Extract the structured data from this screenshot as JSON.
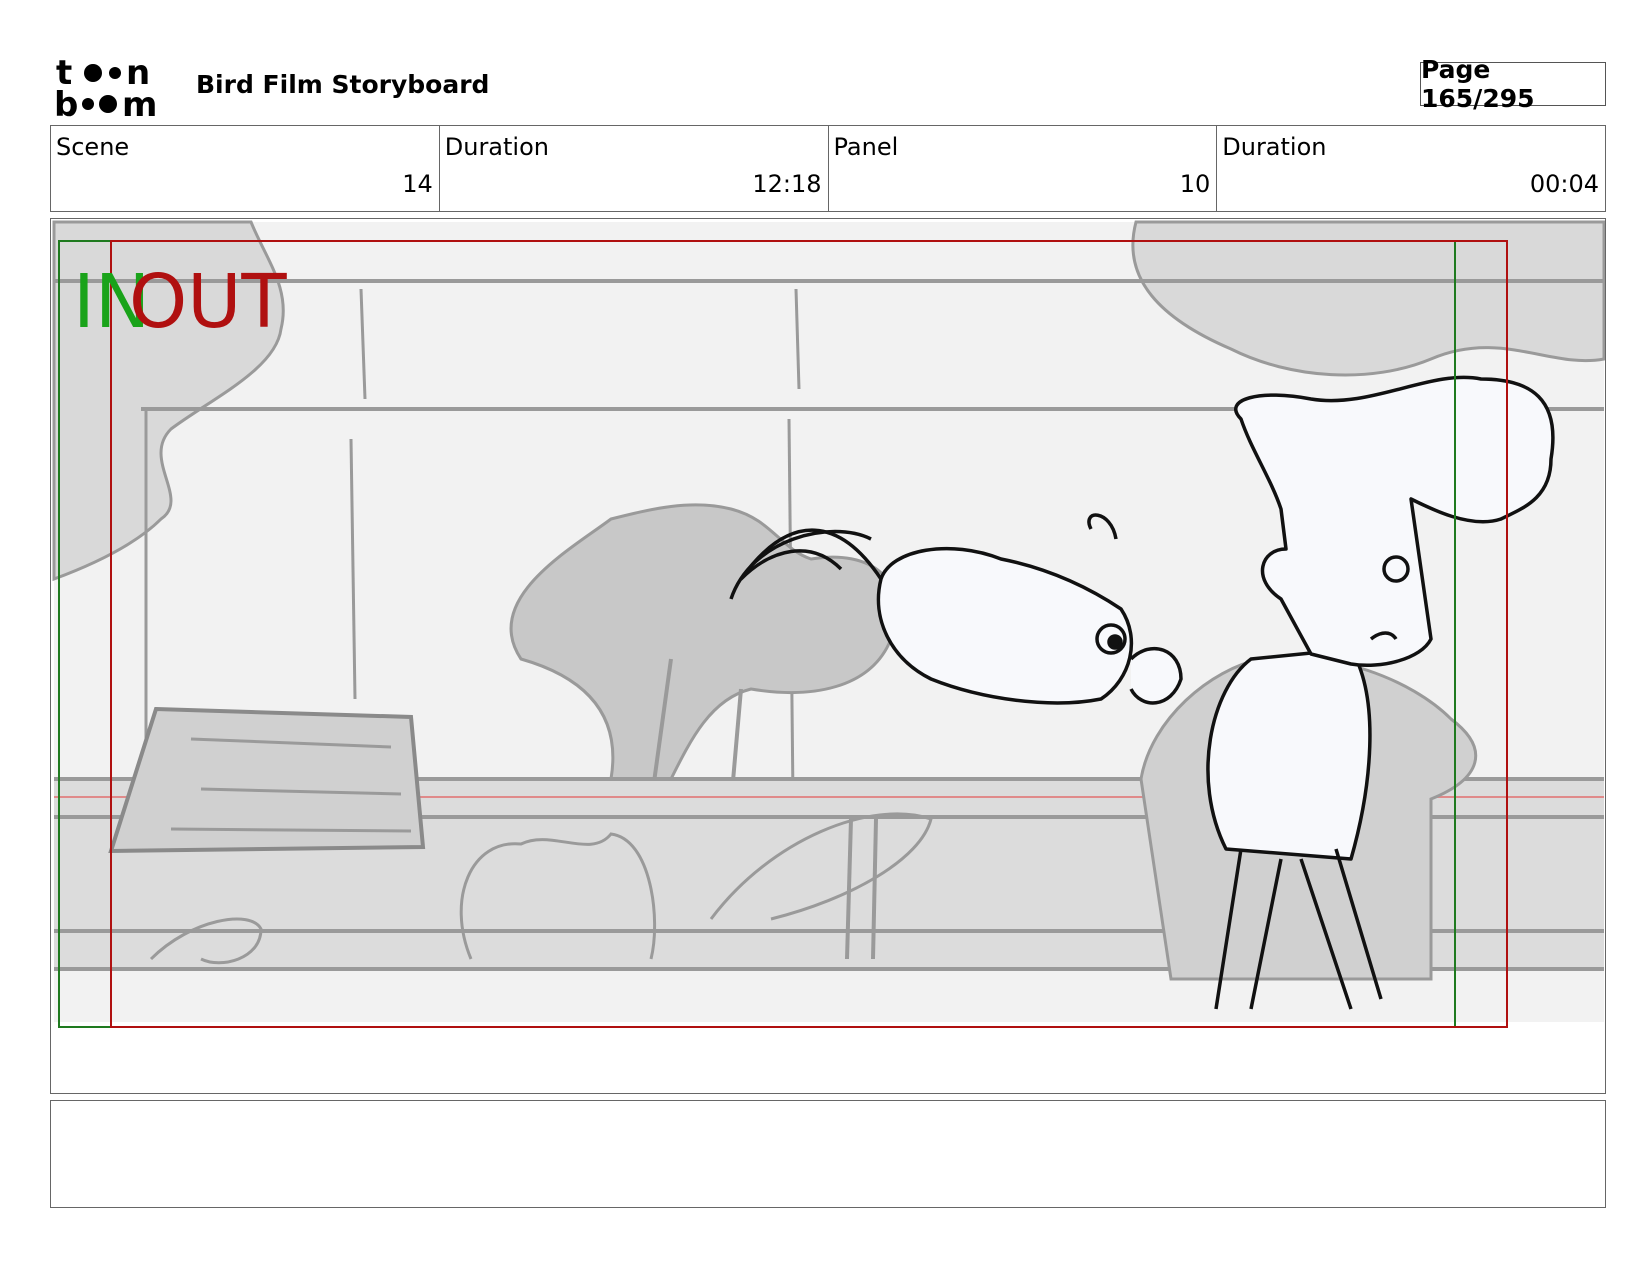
{
  "header": {
    "logo_text": "toon boom",
    "title": "Bird Film Storyboard",
    "page_label": "Page 165/295"
  },
  "info": [
    {
      "label": "Scene",
      "value": "14"
    },
    {
      "label": "Duration",
      "value": "12:18"
    },
    {
      "label": "Panel",
      "value": "10"
    },
    {
      "label": "Duration",
      "value": "00:04"
    }
  ],
  "panel": {
    "in_label": "IN",
    "out_label": "OUT",
    "in_color": "#1aa31a",
    "out_color": "#b01010"
  },
  "notes": {
    "text": ""
  }
}
